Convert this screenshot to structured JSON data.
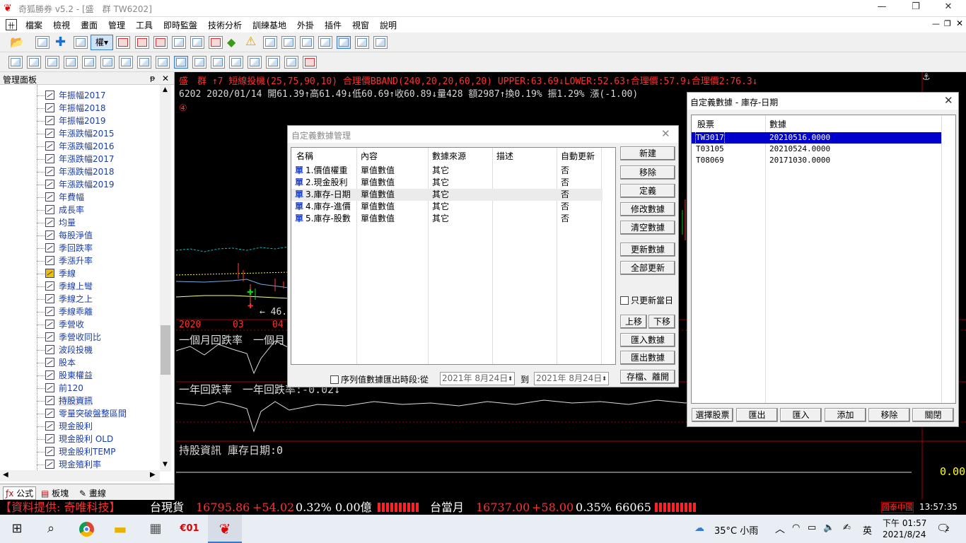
{
  "window": {
    "title": "奇狐勝券 v5.2 - [盛　群 TW6202]"
  },
  "menu": [
    "檔案",
    "檢視",
    "畫面",
    "管理",
    "工具",
    "即時監盤",
    "技術分析",
    "訓練基地",
    "外掛",
    "插件",
    "視窗",
    "說明"
  ],
  "toolbar": {
    "weight_label": "權"
  },
  "panel": {
    "title": "管理面板",
    "pin": "ᵽ",
    "close": "✕",
    "items": [
      "年振幅2017",
      "年振幅2018",
      "年振幅2019",
      "年漲跌幅2015",
      "年漲跌幅2016",
      "年漲跌幅2017",
      "年漲跌幅2018",
      "年漲跌幅2019",
      "年費幅",
      "成長率",
      "均量",
      "每股淨值",
      "季回跌率",
      "季漲升率",
      "季線",
      "季線上彎",
      "季線之上",
      "季線乖離",
      "季營收",
      "季營收同比",
      "波段投機",
      "股本",
      "股東權益",
      "前120",
      "持股資訊",
      "零量突破盤整區間",
      "現金股利",
      "現金股利 OLD",
      "現金股利TEMP",
      "現金殖利率"
    ],
    "tabs": [
      "公式",
      "板塊",
      "畫線"
    ]
  },
  "chart": {
    "line1": "盛　群 ↑7 短線投機(25,75,90,10) 合理價BBAND(240,20,20,60,20) UPPER:63.69↓LOWER:52.63↑合理價:57.9↓合理價2:76.3↓",
    "line2": "6202 2020/01/14 開61.39↑高61.49↓低60.69↑收60.89↓量428 額2987↑換0.19% 振1.29% 漲(-1.00)",
    "marker": "④",
    "axis_year": "2020",
    "axis_m1": "03",
    "axis_m2": "04",
    "low_label": "46.",
    "ind1": "一個月回跌率　一個月",
    "ind2": "一年回跌率　一年回跌率:-0.02↓",
    "ind3": "持股資訊 庫存日期:0",
    "ind3_value": "0.00"
  },
  "dlg_manage": {
    "title": "自定義數據管理",
    "columns": [
      "名稱",
      "內容",
      "數據來源",
      "描述",
      "自動更新"
    ],
    "rows": [
      {
        "icon": "單",
        "name": "1.價值權重",
        "content": "單值數值",
        "source": "其它",
        "desc": "",
        "auto": "否"
      },
      {
        "icon": "單",
        "name": "2.現金股利",
        "content": "單值數值",
        "source": "其它",
        "desc": "",
        "auto": "否"
      },
      {
        "icon": "單",
        "name": "3.庫存-日期",
        "content": "單值數值",
        "source": "其它",
        "desc": "",
        "auto": "否"
      },
      {
        "icon": "單",
        "name": "4.庫存-進價",
        "content": "單值數值",
        "source": "其它",
        "desc": "",
        "auto": "否"
      },
      {
        "icon": "單",
        "name": "5.庫存-股數",
        "content": "單值數值",
        "source": "其它",
        "desc": "",
        "auto": "否"
      }
    ],
    "buttons": {
      "new": "新建",
      "remove": "移除",
      "define": "定義",
      "modify": "修改數據",
      "clear": "清空數據",
      "update": "更新數據",
      "update_all": "全部更新",
      "up": "上移",
      "down": "下移",
      "import": "匯入數據",
      "export": "匯出數據",
      "save_exit": "存檔、離開"
    },
    "only_today": "只更新當日",
    "range_label": "序列值數據匯出時段:從",
    "date_from": "2021年  8月24日",
    "to_label": "到",
    "date_to": "2021年  8月24日"
  },
  "dlg_custom": {
    "title": "自定義數據 - 庫存-日期",
    "columns": [
      "股票",
      "數據"
    ],
    "rows": [
      {
        "stock": "TW3017",
        "value": "20210516.0000"
      },
      {
        "stock": "T03105",
        "value": "20210524.0000"
      },
      {
        "stock": "T08069",
        "value": "20171030.0000"
      }
    ],
    "buttons": [
      "選擇股票",
      "匯出",
      "匯入",
      "添加",
      "移除",
      "關閉"
    ]
  },
  "status": {
    "provider": "【資料提供: 奇唯科技】",
    "q1_name": "台現貨",
    "q1_price": "16795.86",
    "q1_change": "+54.02",
    "q1_pct": "0.32%",
    "q1_vol": "0.00億",
    "q2_name": "台當月",
    "q2_price": "16737.00",
    "q2_change": "+58.00",
    "q2_pct": "0.35%",
    "q2_vol": "66065",
    "broker": "國泰中國",
    "time": "13:57:35"
  },
  "taskbar": {
    "weather": "35°C  小雨",
    "ime": "英",
    "clock_time": "下午 01:57",
    "clock_date": "2021/8/24",
    "notif_count": "2"
  },
  "colors": {
    "up": "#ff3030",
    "down": "#00e000",
    "yellow": "#ffff00",
    "cyan": "#00c0c0"
  }
}
